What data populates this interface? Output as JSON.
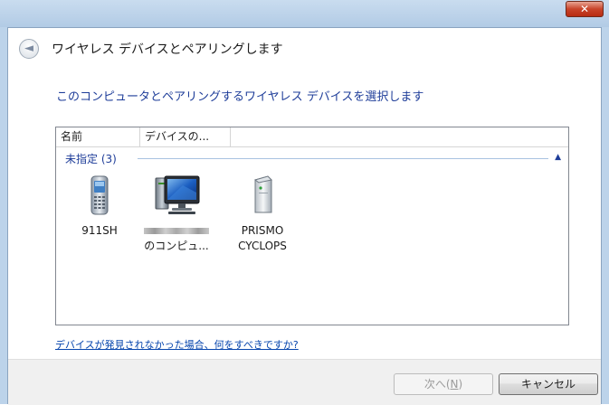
{
  "window": {
    "close_glyph": "✕"
  },
  "header": {
    "title": "ワイヤレス デバイスとペアリングします",
    "back_glyph": "◄"
  },
  "instruction": "このコンピュータとペアリングするワイヤレス デバイスを選択します",
  "list": {
    "columns": [
      "名前",
      "デバイスの..."
    ],
    "group": {
      "label": "未指定 (3)",
      "chevron": "▲"
    },
    "devices": [
      {
        "label1": "911SH",
        "label2": "",
        "icon": "mobile-phone-icon"
      },
      {
        "label1": "",
        "label2": "のコンピュ...",
        "icon": "computer-icon"
      },
      {
        "label1": "PRISMO",
        "label2": "CYCLOPS",
        "icon": "generic-device-icon"
      }
    ]
  },
  "help_link": "デバイスが発見されなかった場合、何をすべきですか?",
  "footer": {
    "next_label": "次へ(",
    "next_key": "N",
    "next_tail": ")",
    "cancel_label": "キャンセル"
  },
  "colors": {
    "accent_link": "#0645ad",
    "instruction_text": "#1e3d99",
    "close_button": "#c8442a"
  }
}
